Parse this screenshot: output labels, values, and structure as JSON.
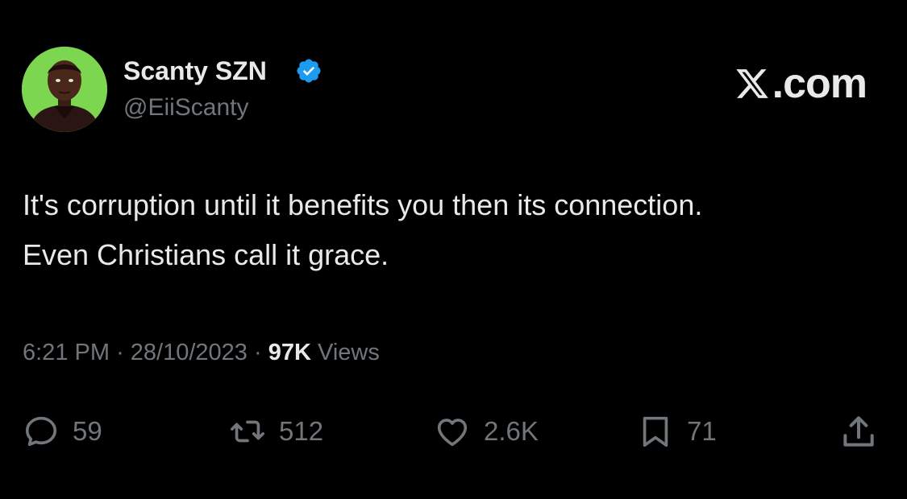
{
  "brand": {
    "label": ".com",
    "icon": "x-logo-icon"
  },
  "author": {
    "display_name": "Scanty SZN",
    "handle": "@EiiScanty",
    "verified": true,
    "avatar_bg": "#7dd64f"
  },
  "tweet": {
    "lines": [
      "It's corruption until it benefits you then its connection.",
      "Even Christians call it grace."
    ]
  },
  "meta": {
    "time": "6:21 PM",
    "sep1": "·",
    "date": "28/10/2023",
    "sep2": "·",
    "views_count": "97K",
    "views_label": "Views"
  },
  "actions": {
    "replies": "59",
    "reposts": "512",
    "likes": "2.6K",
    "bookmarks": "71"
  },
  "colors": {
    "background": "#000000",
    "primary_text": "#e7e9ea",
    "secondary_text": "#71767b",
    "verified_badge": "#1d9bf0"
  }
}
